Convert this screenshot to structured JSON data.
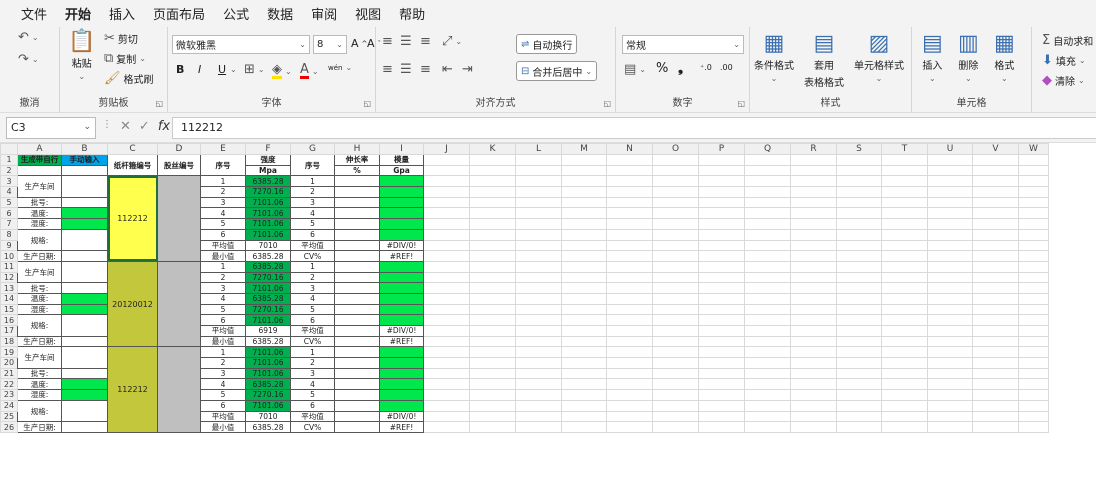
{
  "menu": [
    "文件",
    "开始",
    "插入",
    "页面布局",
    "公式",
    "数据",
    "审阅",
    "视图",
    "帮助"
  ],
  "ribbon": {
    "undo_group": "撤消",
    "clipboard": {
      "paste": "粘贴",
      "cut": "剪切",
      "copy": "复制",
      "format_painter": "格式刷",
      "label": "剪贴板"
    },
    "font": {
      "name": "微软雅黑",
      "size": "8",
      "bold": "B",
      "italic": "I",
      "underline": "U",
      "label": "字体",
      "grow": "A^",
      "shrink": "Aˇ",
      "wen": "wén"
    },
    "align": {
      "wrap": "自动换行",
      "merge": "合并后居中",
      "label": "对齐方式"
    },
    "number": {
      "format": "常规",
      "percent": "%",
      "comma": "❟",
      "label": "数字"
    },
    "styles": {
      "cond": "条件格式",
      "table": "套用",
      "table2": "表格格式",
      "cell": "单元格样式",
      "label": "样式"
    },
    "cells": {
      "insert": "插入",
      "delete": "删除",
      "format": "格式",
      "label": "单元格"
    },
    "editing": {
      "autosum": "自动求和",
      "fill": "填充",
      "clear": "清除"
    }
  },
  "formula_bar": {
    "cell_ref": "C3",
    "value": "112212"
  },
  "columns": [
    "A",
    "B",
    "C",
    "D",
    "E",
    "F",
    "G",
    "H",
    "I",
    "J",
    "K",
    "L",
    "M",
    "N",
    "O",
    "P",
    "Q",
    "R",
    "S",
    "T",
    "U",
    "V",
    "W"
  ],
  "headers": {
    "a1": "生成带自行",
    "b1": "手动输入",
    "c1": "纸杆箍编号",
    "d1": "股丝编号",
    "e1": "序号",
    "f1": "强度",
    "f2": "Mpa",
    "g1": "序号",
    "h1": "伸长率",
    "h2": "%",
    "i1": "模量",
    "i2": "Gpa"
  },
  "labels": {
    "workshop": "生产车间",
    "batch": "批号:",
    "temp": "温度:",
    "humidity": "湿度:",
    "spec": "规格:",
    "date": "生产日期:",
    "avg": "平均值",
    "min": "最小值",
    "cv": "CV%",
    "div0": "#DIV/0!",
    "ref": "#REF!"
  },
  "blocks": [
    {
      "id": "112212",
      "strength": [
        "6385.28",
        "7270.16",
        "7101.06",
        "7101.06",
        "7101.06",
        "7101.06"
      ],
      "avg": "7010",
      "min": "6385.28",
      "color": "yellow"
    },
    {
      "id": "20120012",
      "strength": [
        "6385.28",
        "7270.16",
        "7101.06",
        "6385.28",
        "7270.16",
        "7101.06"
      ],
      "avg": "6919",
      "min": "6385.28",
      "color": "olive"
    },
    {
      "id": "112212",
      "strength": [
        "7101.06",
        "7101.06",
        "7101.06",
        "6385.28",
        "7270.16",
        "7101.06"
      ],
      "avg": "7010",
      "min": "6385.28",
      "color": "olive"
    }
  ],
  "seq": [
    "1",
    "2",
    "3",
    "4",
    "5",
    "6"
  ]
}
